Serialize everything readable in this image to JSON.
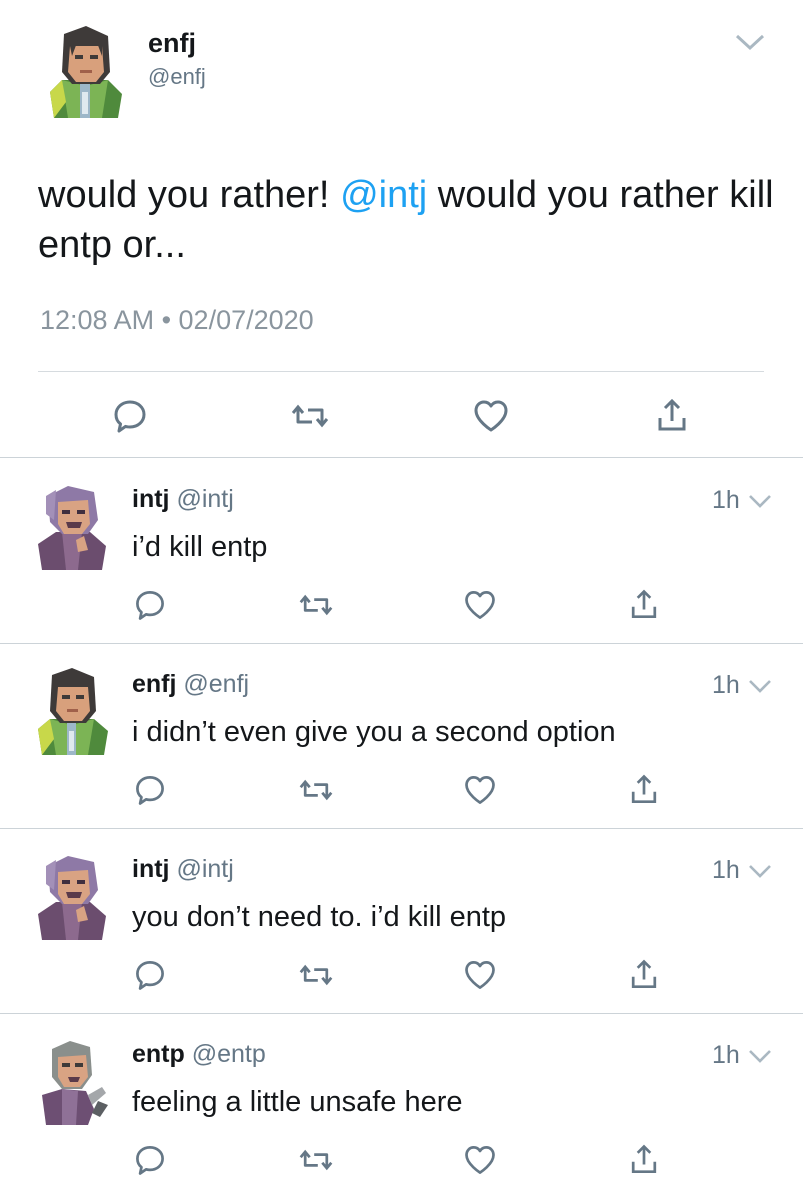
{
  "main_tweet": {
    "name": "enfj",
    "handle": "@enfj",
    "text_before": "would you rather! ",
    "mention": "@intj",
    "text_after": " would you rather kill entp or...",
    "timestamp": "12:08 AM • 02/07/2020",
    "avatar": "enfj-avatar-icon"
  },
  "replies": [
    {
      "name": "intj",
      "handle": "@intj",
      "time": "1h",
      "text": "i’d kill entp",
      "avatar": "intj-avatar-icon"
    },
    {
      "name": "enfj",
      "handle": "@enfj",
      "time": "1h",
      "text": "i didn’t even give you a second option",
      "avatar": "enfj-avatar-icon"
    },
    {
      "name": "intj",
      "handle": "@intj",
      "time": "1h",
      "text": "you don’t need to. i’d kill entp",
      "avatar": "intj-avatar-icon"
    },
    {
      "name": "entp",
      "handle": "@entp",
      "time": "1h",
      "text": "feeling a little unsafe here",
      "avatar": "entp-avatar-icon"
    }
  ],
  "actions": [
    "reply-icon",
    "retweet-icon",
    "like-icon",
    "share-icon"
  ],
  "colors": {
    "mention": "#1da1f2",
    "secondary_text": "#657786",
    "icon": "#657786",
    "divider": "#ccd3d8"
  }
}
